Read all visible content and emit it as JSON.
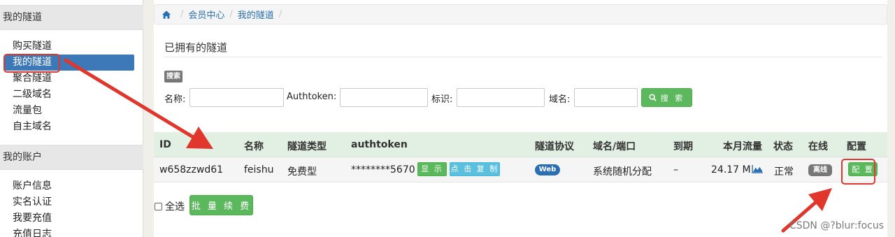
{
  "sidebar": {
    "sections": [
      {
        "title": "我的隧道",
        "items": [
          "购买隧道",
          "我的隧道",
          "聚合隧道",
          "二级域名",
          "流量包",
          "自主域名"
        ]
      },
      {
        "title": "我的账户",
        "items": [
          "账户信息",
          "实名认证",
          "我要充值",
          "充值日志"
        ]
      }
    ],
    "active_item": "我的隧道"
  },
  "breadcrumb": {
    "items": [
      "会员中心",
      "我的隧道"
    ]
  },
  "page": {
    "title": "已拥有的隧道"
  },
  "search": {
    "tag": "搜索",
    "fields": [
      {
        "label": "名称:",
        "value": ""
      },
      {
        "label": "Authtoken:",
        "value": ""
      },
      {
        "label": "标识:",
        "value": ""
      },
      {
        "label": "域名:",
        "value": ""
      }
    ],
    "button_label": "搜 索"
  },
  "table": {
    "columns": [
      "ID",
      "名称",
      "隧道类型",
      "authtoken",
      "隧道协议",
      "域名/端口",
      "到期",
      "本月流量",
      "状态",
      "在线",
      "配置"
    ],
    "rows": [
      {
        "id": "w658zzwd61",
        "name": "feishu",
        "type": "免费型",
        "authtoken": "********5670",
        "show_label": "显 示",
        "copy_label": "点 击 复 制",
        "protocol": "Web",
        "domain": "系统随机分配",
        "expire": "–",
        "traffic": "24.17 M",
        "status": "正常",
        "online": "离线",
        "config_label": "配 置"
      }
    ]
  },
  "footer": {
    "select_all_label": "全选",
    "renew_label": "批 量 续 费"
  },
  "watermark": "CSDN @?blur:focus",
  "colors": {
    "accent_blue": "#3d79b8",
    "link_blue": "#2a6fb5",
    "success_green": "#5cb85c",
    "info_cyan": "#5bc0de",
    "annotation_red": "#e0362c",
    "table_header_bg": "#e2efe3"
  },
  "icons": [
    "home-icon",
    "search-icon",
    "traffic-chart-icon"
  ]
}
